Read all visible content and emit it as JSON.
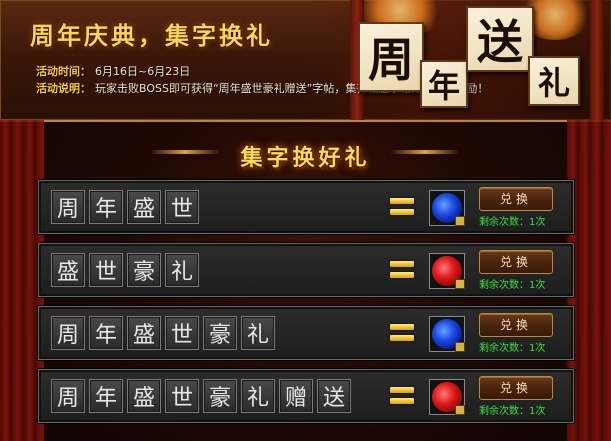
{
  "header": {
    "title": "周年庆典，集字换礼",
    "time_label": "活动时间：",
    "time_value": "6月16日~6月23日",
    "desc_label": "活动说明：",
    "desc_value": "玩家击败BOSS即可获得“周年盛世豪礼赠送”字帖，集齐相应字帖即可兑换奖励！",
    "big_chars": [
      "周",
      "年",
      "送",
      "礼"
    ]
  },
  "subtitle": "集字换好礼",
  "rows": [
    {
      "chars": [
        "周",
        "年",
        "盛",
        "世"
      ],
      "reward_color": "blue",
      "button": "兑换",
      "remain": "剩余次数：1次"
    },
    {
      "chars": [
        "盛",
        "世",
        "豪",
        "礼"
      ],
      "reward_color": "red",
      "button": "兑换",
      "remain": "剩余次数：1次"
    },
    {
      "chars": [
        "周",
        "年",
        "盛",
        "世",
        "豪",
        "礼"
      ],
      "reward_color": "blue",
      "button": "兑换",
      "remain": "剩余次数：1次"
    },
    {
      "chars": [
        "周",
        "年",
        "盛",
        "世",
        "豪",
        "礼",
        "赠",
        "送"
      ],
      "reward_color": "red",
      "button": "兑换",
      "remain": "剩余次数：1次"
    }
  ],
  "colors": {
    "title_gold": "#ffd35a",
    "remain_green": "#39e03a",
    "button_text": "#f6e2b0"
  }
}
